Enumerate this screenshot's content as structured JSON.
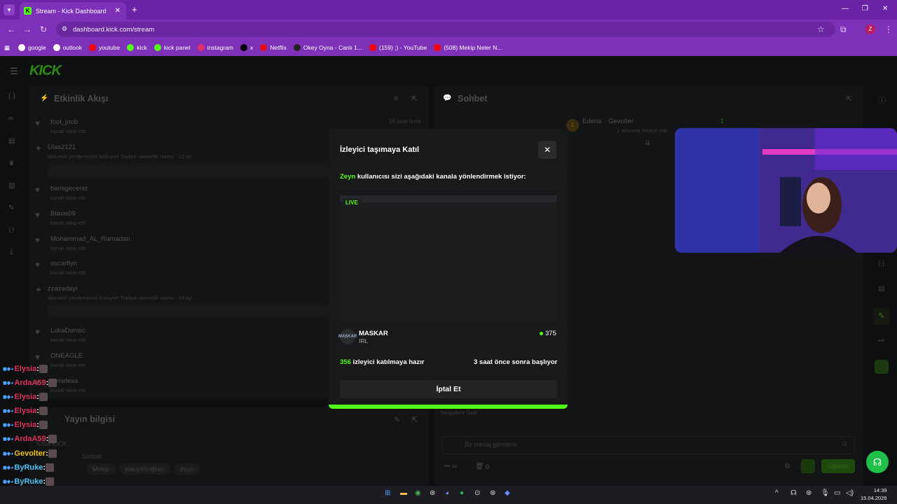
{
  "browser": {
    "tab_title": "Stream - Kick Dashboard",
    "url": "dashboard.kick.com/stream",
    "bookmarks": [
      {
        "label": "google",
        "color": "#ffffff"
      },
      {
        "label": "outlook",
        "color": "#ffffff"
      },
      {
        "label": "youtube",
        "color": "#ff0000"
      },
      {
        "label": "kick",
        "color": "#53fc18"
      },
      {
        "label": "kick panel",
        "color": "#53fc18"
      },
      {
        "label": "instagram",
        "color": "#e1306c"
      },
      {
        "label": "x",
        "color": "#000000"
      },
      {
        "label": "Netflix",
        "color": "#e50914"
      },
      {
        "label": "Okey Oyna - Canlı 1...",
        "color": "#222222"
      },
      {
        "label": "(159) ;) - YouTube",
        "color": "#ff0000"
      },
      {
        "label": "(508) Mekip Neler N...",
        "color": "#ff0000"
      }
    ]
  },
  "activity": {
    "title": "Etkinlik Akışı",
    "items": [
      {
        "name": "foot_joob",
        "sub": "kanalı takip etti",
        "time": "16 saat önce"
      },
      {
        "name": "Ulas2121",
        "sub": "abonelik yenilemesini kutluyor! Toplam abonelik süresi - 12 ay!",
        "time": ""
      },
      {
        "name": "barisgeceniz",
        "sub": "kanalı takip etti",
        "time": ""
      },
      {
        "name": "Blaxis09",
        "sub": "kanalı takip etti",
        "time": ""
      },
      {
        "name": "Mohammad_AL_Ramadan",
        "sub": "kanalı takip etti",
        "time": ""
      },
      {
        "name": "oscarflyn",
        "sub": "kanalı takip etti",
        "time": ""
      },
      {
        "name": "zzazadayi",
        "sub": "abonelik yenilemesini kutluyor! Toplam abonelik süresi - 19 ay!",
        "time": ""
      },
      {
        "name": "LukaDonsic",
        "sub": "kanalı takip etti",
        "time": ""
      },
      {
        "name": "ONEAGLE",
        "sub": "kanalı takip etti",
        "time": ""
      },
      {
        "name": "Veneleas",
        "sub": "kanalı takip etti",
        "time": ""
      }
    ]
  },
  "stream_info": {
    "title": "Yayın bilgisi",
    "kisa": "KISA KICK",
    "chat_label": "Sohbet",
    "tags": [
      "Mekip",
      "yakışıklıoğlum",
      "zeyn"
    ]
  },
  "chat": {
    "title": "Sohbet",
    "top_user": "Ederia",
    "top_user2": "Gevolter",
    "top_count": "1",
    "sub_note": "1 abonelik hediye ede",
    "follower_label": "Takipçilere Özel",
    "input_placeholder": "Bir mesaj gönderin",
    "bottom_count": "0",
    "send_label": "Gönder"
  },
  "overlay": [
    {
      "user": "Elysia",
      "color": "#e0315c"
    },
    {
      "user": "ArdaA59",
      "color": "#e0315c"
    },
    {
      "user": "Elysia",
      "color": "#e0315c"
    },
    {
      "user": "Elysia",
      "color": "#e0315c"
    },
    {
      "user": "Elysia",
      "color": "#e0315c"
    },
    {
      "user": "ArdaA59",
      "color": "#e0315c"
    },
    {
      "user": "Gevolter",
      "color": "#f0c419"
    },
    {
      "user": "ByRuke",
      "color": "#4fc3f7"
    },
    {
      "user": "ByRuke",
      "color": "#4fc3f7"
    },
    {
      "user": "ByRuke",
      "color": "#4fc3f7"
    }
  ],
  "modal": {
    "title": "İzleyici taşımaya Katıl",
    "requester": "Zeyn",
    "redirect_text": "kullanıcısı sizi aşağıdaki kanala yönlendirmek istiyor:",
    "live_badge": "LIVE",
    "channel_name": "MASKAR",
    "channel_category": "IRL",
    "channel_logo_text": "MASKAR",
    "viewers": "375",
    "ready_count": "356",
    "ready_text": "izleyici katılmaya hazır",
    "starts_text": "3 saat önce sonra başlıyor",
    "cancel_label": "İptal Et",
    "close_label": "✕"
  },
  "taskbar": {
    "time": "14:39",
    "date": "15.04.2026"
  },
  "colors": {
    "brand_green": "#53fc18",
    "browser_purple": "#7d30b8"
  }
}
